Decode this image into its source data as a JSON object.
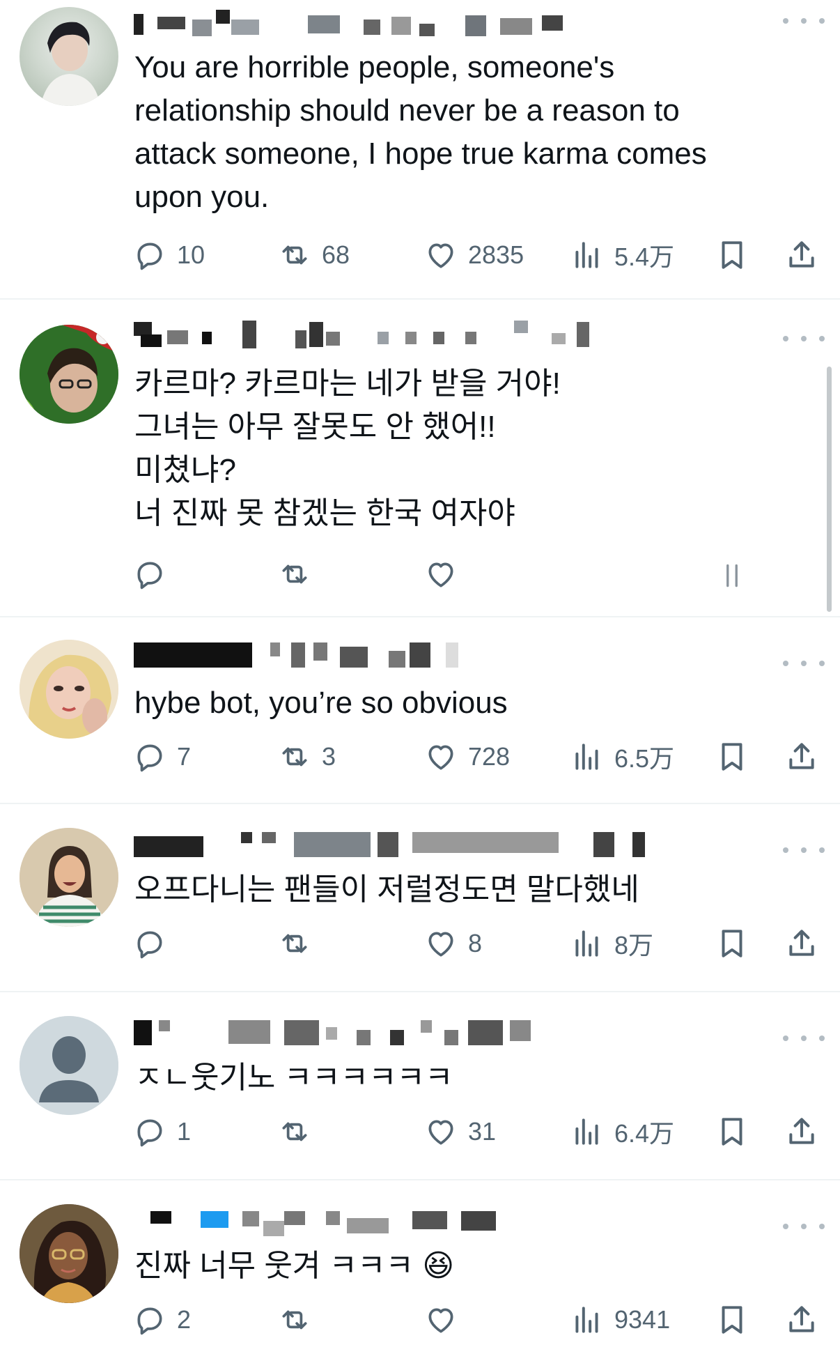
{
  "posts": [
    {
      "avatar": "young-man-portrait",
      "text": "You are horrible people, someone's\nrelationship should never be a reason to\nattack someone, I hope true karma comes\nupon you.",
      "replies": "10",
      "reposts": "68",
      "likes": "2835",
      "views": "5.4万"
    },
    {
      "avatar": "santa-hat-selfie",
      "text": "카르마? 카르마는 네가 받을 거야!\n그녀는 아무 잘못도 안 했어!!\n미쳤냐?\n너 진짜 못 참겠는 한국 여자야",
      "replies": "",
      "reposts": "",
      "likes": "",
      "views": ""
    },
    {
      "avatar": "blonde-woman-portrait",
      "text": "hybe bot, you’re so obvious",
      "replies": "7",
      "reposts": "3",
      "likes": "728",
      "views": "6.5万"
    },
    {
      "avatar": "smiling-woman-photo",
      "text": "오프다니는 팬들이 저럴정도면 말다했네",
      "replies": "",
      "reposts": "",
      "likes": "8",
      "views": "8万"
    },
    {
      "avatar": "default-user-icon",
      "text": "ㅈㄴ웃기노 ㅋㅋㅋㅋㅋㅋ",
      "replies": "1",
      "reposts": "",
      "likes": "31",
      "views": "6.4万"
    },
    {
      "avatar": "illustrated-woman-glasses",
      "text": "진짜 너무 웃겨 ㅋㅋㅋ 😆",
      "replies": "2",
      "reposts": "",
      "likes": "",
      "views": "9341"
    }
  ],
  "colors": {
    "text": "#0f1419",
    "muted": "#536471",
    "divider": "#eff3f4",
    "accent": "#1d9bf0"
  }
}
